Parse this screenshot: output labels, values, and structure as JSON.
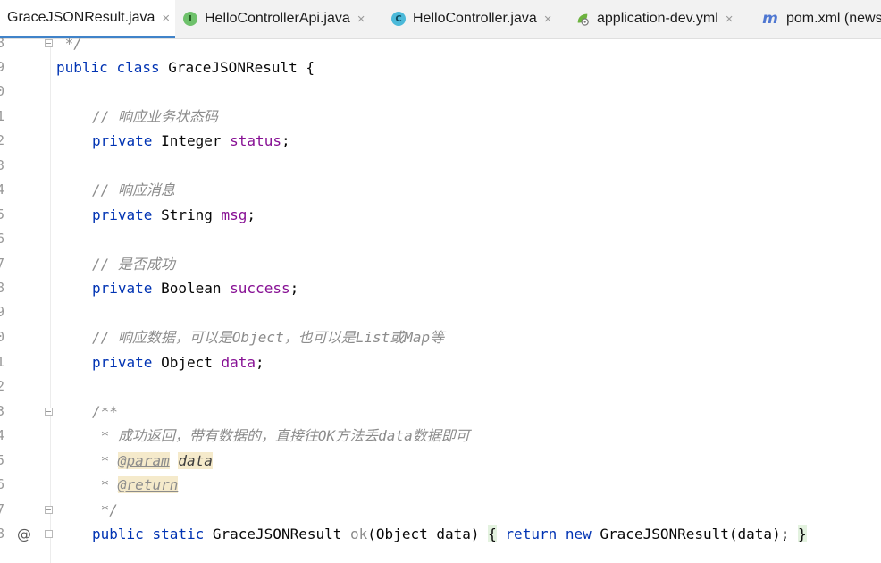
{
  "tabs": [
    {
      "label": "GraceJSONResult.java",
      "icon": "java-class-icon",
      "active": true
    },
    {
      "label": "HelloControllerApi.java",
      "icon": "interface-icon",
      "active": false
    },
    {
      "label": "HelloController.java",
      "icon": "class-icon",
      "active": false
    },
    {
      "label": "application-dev.yml",
      "icon": "spring-yml-icon",
      "active": false
    },
    {
      "label": "pom.xml (news",
      "icon": "maven-icon",
      "active": false
    }
  ],
  "close_glyph": "×",
  "gutter_marker": "@",
  "lines": [
    {
      "num": "8",
      "tokens": {
        "a": " */"
      }
    },
    {
      "num": "9",
      "tokens": {
        "kw1": "public",
        "kw2": "class",
        "name": "GraceJSONResult",
        "rest": "{"
      }
    },
    {
      "num": "0"
    },
    {
      "num": "1",
      "tokens": {
        "c": "// 响应业务状态码"
      }
    },
    {
      "num": "2",
      "tokens": {
        "kw": "private",
        "type": "Integer",
        "fld": "status",
        "end": ";"
      }
    },
    {
      "num": "3"
    },
    {
      "num": "4",
      "tokens": {
        "c": "// 响应消息"
      }
    },
    {
      "num": "5",
      "tokens": {
        "kw": "private",
        "type": "String",
        "fld": "msg",
        "end": ";"
      }
    },
    {
      "num": "6"
    },
    {
      "num": "7",
      "tokens": {
        "c": "// 是否成功"
      }
    },
    {
      "num": "8",
      "tokens": {
        "kw": "private",
        "type": "Boolean",
        "fld": "success",
        "end": ";"
      }
    },
    {
      "num": "9"
    },
    {
      "num": "0",
      "tokens": {
        "c": "// 响应数据，可以是Object，也可以是List或Map等"
      }
    },
    {
      "num": "1",
      "tokens": {
        "kw": "private",
        "type": "Object",
        "fld": "data",
        "end": ";"
      }
    },
    {
      "num": "2"
    },
    {
      "num": "3",
      "tokens": {
        "c": "/**"
      }
    },
    {
      "num": "4",
      "tokens": {
        "c": " * 成功返回，带有数据的，直接往OK方法丢data数据即可"
      }
    },
    {
      "num": "5",
      "tokens": {
        "star": " * ",
        "tag": "@param",
        "sp": " ",
        "pname": "data"
      }
    },
    {
      "num": "6",
      "tokens": {
        "star": " * ",
        "tag": "@return"
      }
    },
    {
      "num": "7",
      "tokens": {
        "c": " */"
      }
    },
    {
      "num": "8",
      "tokens": {
        "kw1": "public",
        "kw2": "static",
        "type": "GraceJSONResult",
        "m": "ok",
        "params": "(Object data) ",
        "lb": "{",
        "kw3": "return",
        "kw4": "new",
        "call": "GraceJSONResult(data);",
        "rb": "}"
      }
    }
  ]
}
